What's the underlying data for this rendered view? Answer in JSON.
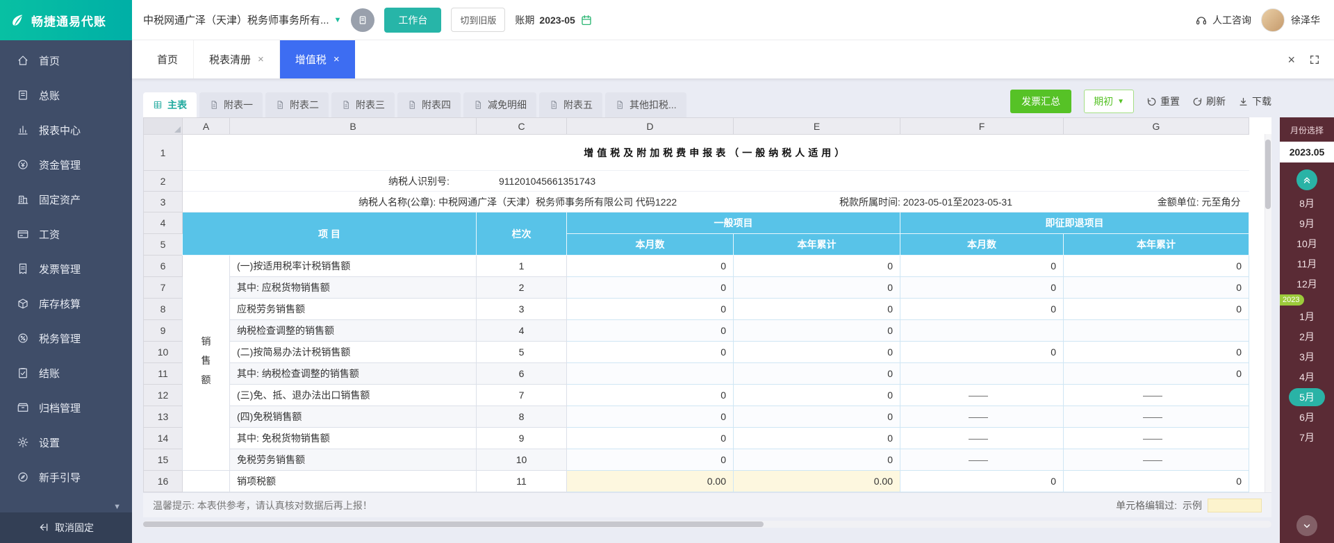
{
  "brand": {
    "name": "畅捷通易代账"
  },
  "sidebar": {
    "items": [
      {
        "id": "home",
        "icon": "home",
        "label": "首页"
      },
      {
        "id": "general-ledger",
        "icon": "ledger",
        "label": "总账"
      },
      {
        "id": "report-center",
        "icon": "chart",
        "label": "报表中心"
      },
      {
        "id": "fund-management",
        "icon": "fund",
        "label": "资金管理"
      },
      {
        "id": "fixed-assets",
        "icon": "asset",
        "label": "固定资产"
      },
      {
        "id": "salary",
        "icon": "salary",
        "label": "工资"
      },
      {
        "id": "invoice-management",
        "icon": "invoice",
        "label": "发票管理"
      },
      {
        "id": "inventory-accounting",
        "icon": "inventory",
        "label": "库存核算"
      },
      {
        "id": "tax-management",
        "icon": "tax",
        "label": "税务管理"
      },
      {
        "id": "closing",
        "icon": "closing",
        "label": "结账"
      },
      {
        "id": "archive-management",
        "icon": "archive",
        "label": "归档管理"
      },
      {
        "id": "settings",
        "icon": "settings",
        "label": "设置"
      },
      {
        "id": "beginner-guide",
        "icon": "guide",
        "label": "新手引导"
      }
    ],
    "unpin_label": "取消固定"
  },
  "topbar": {
    "company": "中税网通广泽（天津）税务师事务所有...",
    "workbench_label": "工作台",
    "switch_old_label": "切到旧版",
    "period_label": "账期",
    "period_value": "2023-05",
    "support_label": "人工咨询",
    "user_name": "徐泽华"
  },
  "tabs": [
    {
      "label": "首页",
      "closable": false,
      "active": false
    },
    {
      "label": "税表清册",
      "closable": true,
      "active": false
    },
    {
      "label": "增值税",
      "closable": true,
      "active": true
    }
  ],
  "toolbar": {
    "subtabs": [
      {
        "label": "主表",
        "active": true
      },
      {
        "label": "附表一",
        "active": false
      },
      {
        "label": "附表二",
        "active": false
      },
      {
        "label": "附表三",
        "active": false
      },
      {
        "label": "附表四",
        "active": false
      },
      {
        "label": "减免明细",
        "active": false
      },
      {
        "label": "附表五",
        "active": false
      },
      {
        "label": "其他扣税...",
        "active": false
      }
    ],
    "invoice_summary_label": "发票汇总",
    "period_begin_label": "期初",
    "reset_label": "重置",
    "refresh_label": "刷新",
    "download_label": "下载"
  },
  "sheet": {
    "column_letters": [
      "A",
      "B",
      "C",
      "D",
      "E",
      "F",
      "G"
    ],
    "title": "增值税及附加税费申报表（一般纳税人适用）",
    "taxpayer_id_label": "纳税人识别号:",
    "taxpayer_id": "911201045661351743",
    "taxpayer_name_label": "纳税人名称(公章):",
    "taxpayer_name": "中税网通广泽（天津）税务师事务所有限公司 代码1222",
    "tax_period_label": "税款所属时间:",
    "tax_period": "2023-05-01至2023-05-31",
    "unit_label": "金额单位:",
    "unit": "元至角分",
    "header": {
      "item": "项 目",
      "line_no": "栏次",
      "general": "一般项目",
      "refund": "即征即退项目",
      "month": "本月数",
      "year_total": "本年累计"
    },
    "group_label": "销 售 额",
    "rows": [
      {
        "num": 6,
        "item": "(一)按适用税率计税销售额",
        "no": "1",
        "vals": [
          "0",
          "0",
          "0",
          "0"
        ]
      },
      {
        "num": 7,
        "item": "其中: 应税货物销售额",
        "no": "2",
        "vals": [
          "0",
          "0",
          "0",
          "0"
        ]
      },
      {
        "num": 8,
        "item": "应税劳务销售额",
        "no": "3",
        "vals": [
          "0",
          "0",
          "0",
          "0"
        ]
      },
      {
        "num": 9,
        "item": "纳税检查调整的销售额",
        "no": "4",
        "vals": [
          "0",
          "0",
          "",
          ""
        ]
      },
      {
        "num": 10,
        "item": "(二)按简易办法计税销售额",
        "no": "5",
        "vals": [
          "0",
          "0",
          "0",
          "0"
        ]
      },
      {
        "num": 11,
        "item": "其中: 纳税检查调整的销售额",
        "no": "6",
        "vals": [
          "",
          "0",
          "",
          "0"
        ]
      },
      {
        "num": 12,
        "item": "(三)免、抵、退办法出口销售额",
        "no": "7",
        "vals": [
          "0",
          "0",
          "——",
          "——"
        ]
      },
      {
        "num": 13,
        "item": "(四)免税销售额",
        "no": "8",
        "vals": [
          "0",
          "0",
          "——",
          "——"
        ]
      },
      {
        "num": 14,
        "item": "其中: 免税货物销售额",
        "no": "9",
        "vals": [
          "0",
          "0",
          "——",
          "——"
        ]
      },
      {
        "num": 15,
        "item": "免税劳务销售额",
        "no": "10",
        "vals": [
          "0",
          "0",
          "——",
          "——"
        ]
      },
      {
        "num": 16,
        "item": "销项税额",
        "no": "11",
        "vals": [
          "0.00",
          "0.00",
          "0",
          "0"
        ]
      }
    ]
  },
  "footer": {
    "tip": "温馨提示: 本表供参考，请认真核对数据后再上报！",
    "edited_label": "单元格编辑过:",
    "edited_example": "示例"
  },
  "month_panel": {
    "title": "月份选择",
    "current": "2023.05",
    "year_badge": "2023",
    "badge_before": "1月",
    "months": [
      "8月",
      "9月",
      "10月",
      "11月",
      "12月",
      "1月",
      "2月",
      "3月",
      "4月",
      "5月",
      "6月",
      "7月"
    ],
    "selected": "5月"
  },
  "colors": {
    "accent_teal": "#27B5A8",
    "active_tab_blue": "#3D6DF2",
    "table_header_blue": "#58C3E8",
    "green_button": "#56C226",
    "month_panel_maroon": "#5A2B35",
    "edited_cell_yellow": "#FCF3CD"
  }
}
